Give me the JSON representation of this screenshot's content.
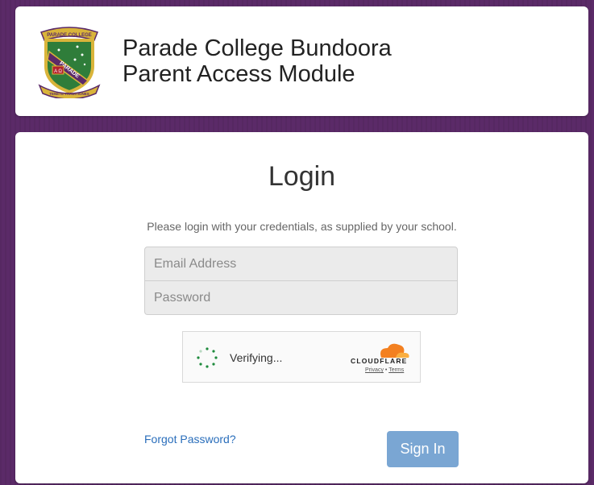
{
  "header": {
    "school_line1": "Parade College Bundoora",
    "school_line2": "Parent Access Module",
    "logo": {
      "icon": "school-crest-icon",
      "top_text": "PARADE COLLEGE",
      "band_text": "PARADE",
      "motto": "TENETE TRADITIONES",
      "letters": "A Ω",
      "colors": {
        "shield_green": "#2f7d3a",
        "border_gold": "#d9b43a",
        "purple": "#5b2a68",
        "red": "#b3232d"
      }
    }
  },
  "login": {
    "title": "Login",
    "instructions": "Please login with your credentials, as supplied by your school.",
    "email_placeholder": "Email Address",
    "password_placeholder": "Password",
    "captcha": {
      "status": "Verifying...",
      "provider": "CLOUDFLARE",
      "privacy_label": "Privacy",
      "separator": "•",
      "terms_label": "Terms",
      "spinner_icon": "loading-spinner-icon",
      "cloud_icon": "cloudflare-cloud-icon",
      "cloud_color": "#f38020"
    },
    "forgot_label": "Forgot Password?",
    "signin_label": "Sign In"
  },
  "colors": {
    "background": "#5b2a68",
    "button": "#7aa6d3",
    "link": "#2a6ebb"
  }
}
